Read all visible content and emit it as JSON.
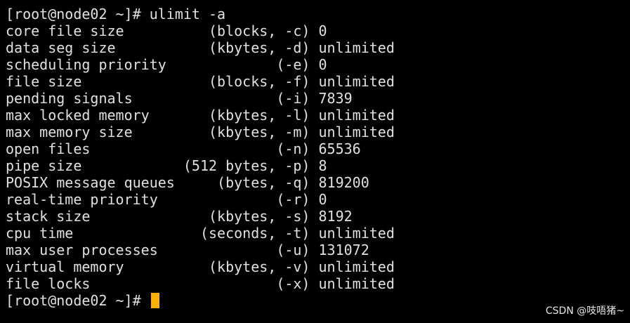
{
  "terminal": {
    "prompt": "[root@node02 ~]#",
    "command": "ulimit -a",
    "output": [
      "core file size          (blocks, -c) 0",
      "data seg size           (kbytes, -d) unlimited",
      "scheduling priority             (-e) 0",
      "file size               (blocks, -f) unlimited",
      "pending signals                 (-i) 7839",
      "max locked memory       (kbytes, -l) unlimited",
      "max memory size         (kbytes, -m) unlimited",
      "open files                      (-n) 65536",
      "pipe size            (512 bytes, -p) 8",
      "POSIX message queues     (bytes, -q) 819200",
      "real-time priority              (-r) 0",
      "stack size              (kbytes, -s) 8192",
      "cpu time               (seconds, -t) unlimited",
      "max user processes              (-u) 131072",
      "virtual memory          (kbytes, -v) unlimited",
      "file locks                      (-x) unlimited"
    ],
    "final_prompt": "[root@node02 ~]#"
  },
  "watermark": "CSDN @吱唔猪~",
  "colors": {
    "background": "#000000",
    "text": "#e0e0e0",
    "cursor": "#ffb000"
  }
}
